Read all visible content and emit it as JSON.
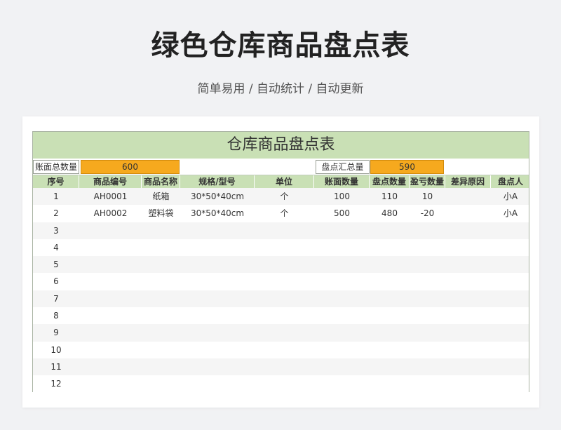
{
  "page": {
    "title": "绿色仓库商品盘点表",
    "subtitle": "简单易用 / 自动统计 / 自动更新"
  },
  "sheet": {
    "title": "仓库商品盘点表",
    "summary": {
      "book_total_label": "账面总数量",
      "book_total_value": "600",
      "count_total_label": "盘点汇总量",
      "count_total_value": "590"
    },
    "headers": [
      "序号",
      "商品编号",
      "商品名称",
      "规格/型号",
      "单位",
      "账面数量",
      "盘点数量",
      "盈亏数量",
      "差异原因",
      "盘点人"
    ],
    "rows": [
      [
        "1",
        "AH0001",
        "纸箱",
        "30*50*40cm",
        "个",
        "100",
        "110",
        "10",
        "",
        "小A"
      ],
      [
        "2",
        "AH0002",
        "塑料袋",
        "30*50*40cm",
        "个",
        "500",
        "480",
        "-20",
        "",
        "小A"
      ],
      [
        "3",
        "",
        "",
        "",
        "",
        "",
        "",
        "",
        "",
        ""
      ],
      [
        "4",
        "",
        "",
        "",
        "",
        "",
        "",
        "",
        "",
        ""
      ],
      [
        "5",
        "",
        "",
        "",
        "",
        "",
        "",
        "",
        "",
        ""
      ],
      [
        "6",
        "",
        "",
        "",
        "",
        "",
        "",
        "",
        "",
        ""
      ],
      [
        "7",
        "",
        "",
        "",
        "",
        "",
        "",
        "",
        "",
        ""
      ],
      [
        "8",
        "",
        "",
        "",
        "",
        "",
        "",
        "",
        "",
        ""
      ],
      [
        "9",
        "",
        "",
        "",
        "",
        "",
        "",
        "",
        "",
        ""
      ],
      [
        "10",
        "",
        "",
        "",
        "",
        "",
        "",
        "",
        "",
        ""
      ],
      [
        "11",
        "",
        "",
        "",
        "",
        "",
        "",
        "",
        "",
        ""
      ],
      [
        "12",
        "",
        "",
        "",
        "",
        "",
        "",
        "",
        "",
        ""
      ]
    ]
  }
}
